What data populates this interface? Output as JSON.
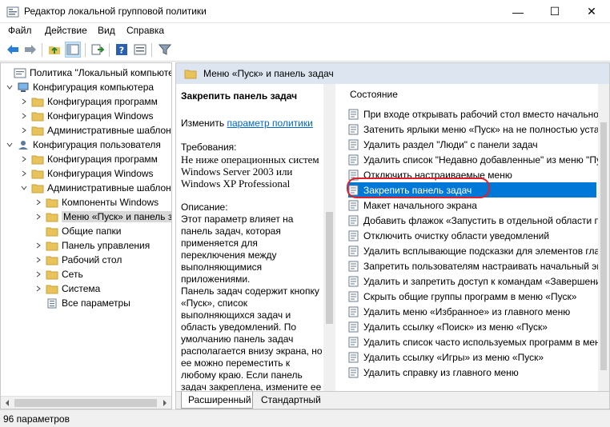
{
  "window": {
    "title": "Редактор локальной групповой политики",
    "minimize": "—",
    "maximize": "☐",
    "close": "✕"
  },
  "menu": [
    "Файл",
    "Действие",
    "Вид",
    "Справка"
  ],
  "toolbar": {
    "buttons": [
      "back-arrow-icon",
      "forward-arrow-icon",
      "up-folder-icon",
      "show-hide-tree-icon",
      "export-list-icon",
      "help-icon",
      "console-view-icon",
      "filter-icon"
    ]
  },
  "tree": {
    "items": [
      {
        "label": "Политика \"Локальный компьютер\""
      },
      {
        "label": "Конфигурация компьютера"
      },
      {
        "label": "Конфигурация программ"
      },
      {
        "label": "Конфигурация Windows"
      },
      {
        "label": "Административные шаблоны"
      },
      {
        "label": "Конфигурация пользователя"
      },
      {
        "label": "Конфигурация программ"
      },
      {
        "label": "Конфигурация Windows"
      },
      {
        "label": "Административные шаблоны"
      },
      {
        "label": "Компоненты Windows"
      },
      {
        "label": "Меню «Пуск» и панель задач"
      },
      {
        "label": "Общие папки"
      },
      {
        "label": "Панель управления"
      },
      {
        "label": "Рабочий стол"
      },
      {
        "label": "Сеть"
      },
      {
        "label": "Система"
      },
      {
        "label": "Все параметры"
      }
    ]
  },
  "right": {
    "header": "Меню «Пуск» и панель задач",
    "description": {
      "title": "Закрепить панель задач",
      "edit_prefix": "Изменить",
      "edit_link": "параметр политики",
      "requirements_label": "Требования:",
      "requirements_text": "Не ниже операционных систем Windows Server 2003 или Windows XP Professional",
      "description_label": "Описание:",
      "p1": "Этот параметр влияет на панель задач, которая применяется для переключения между выполняющимися приложениями.",
      "p2": "Панель задач содержит кнопку «Пуск», список выполняющихся задач и область уведомлений. По умолчанию панель задач располагается внизу экрана, но ее можно переместить к любому краю. Если панель задач закреплена, измените ее"
    },
    "list_header": "Состояние",
    "settings": [
      {
        "label": "При входе открывать рабочий стол вместо начального экрана"
      },
      {
        "label": "Затенить ярлыки меню «Пуск» на не полностью установленные программы"
      },
      {
        "label": "Удалить раздел \"Люди\" с панели задач"
      },
      {
        "label": "Удалить список \"Недавно добавленные\" из меню \"Пуск\""
      },
      {
        "label": "Отключить настраиваемые меню"
      },
      {
        "label": "Закрепить панель задач"
      },
      {
        "label": "Макет начального экрана"
      },
      {
        "label": "Добавить флажок «Запустить в отдельной области памяти»"
      },
      {
        "label": "Отключить очистку области уведомлений"
      },
      {
        "label": "Удалить всплывающие подсказки для элементов главного меню"
      },
      {
        "label": "Запретить пользователям настраивать начальный экран"
      },
      {
        "label": "Удалить и запретить доступ к командам «Завершение работы»"
      },
      {
        "label": "Скрыть общие группы программ в меню «Пуск»"
      },
      {
        "label": "Удалить меню «Избранное» из главного меню"
      },
      {
        "label": "Удалить ссылку «Поиск» из меню «Пуск»"
      },
      {
        "label": "Удалить список часто используемых программ в меню «Пуск»"
      },
      {
        "label": "Удалить ссылку «Игры» из меню «Пуск»"
      },
      {
        "label": "Удалить справку из главного меню"
      }
    ],
    "selected_index": 5,
    "tabs": [
      "Расширенный",
      "Стандартный"
    ]
  },
  "status": {
    "text": "96 параметров"
  },
  "colors": {
    "selection": "#0078d7",
    "header_band": "#dde6f0",
    "folder": "#e8c25a",
    "link": "#0066cc",
    "annotation_ring": "#e0202a"
  }
}
